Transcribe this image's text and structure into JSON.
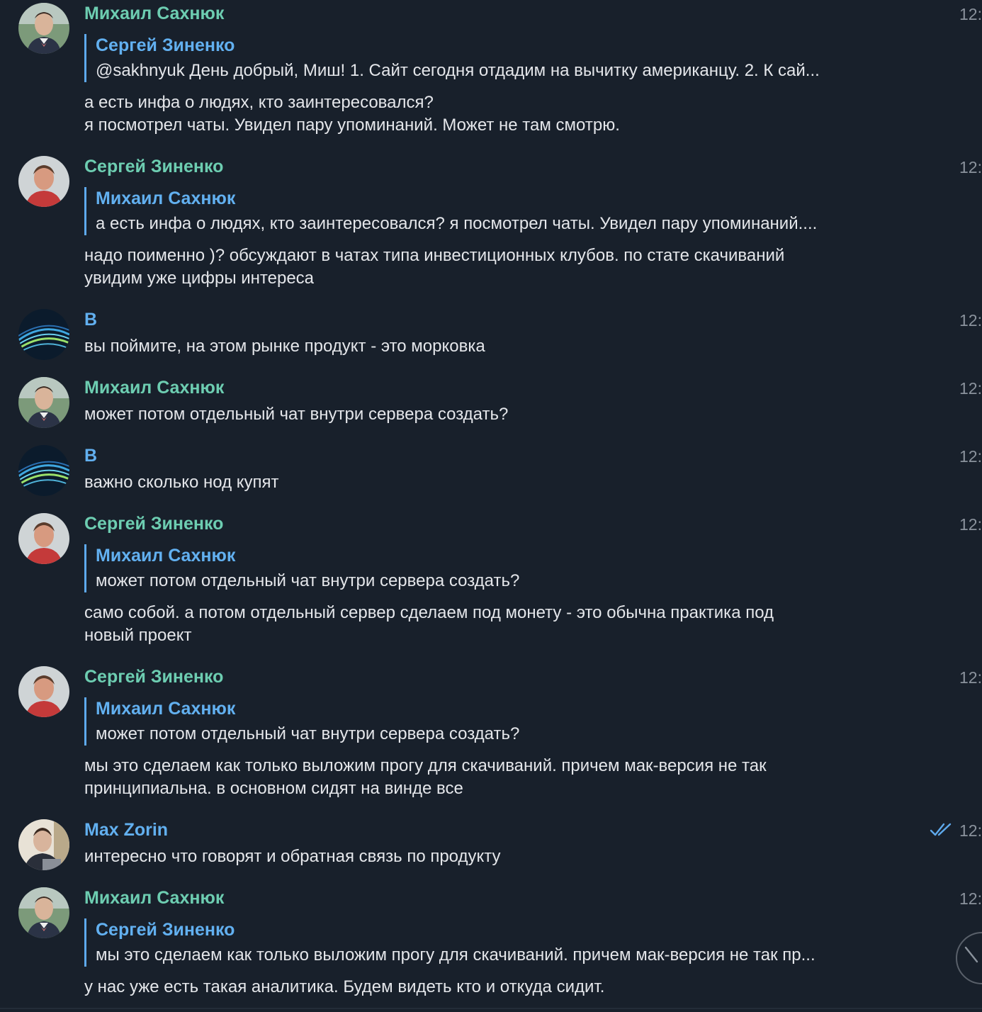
{
  "colors": {
    "background": "#18202b",
    "author_green": "#6dcdb1",
    "author_blue": "#62b0f0",
    "quote_bar": "#5ea9ec",
    "text": "#e4e6ea",
    "time": "#8a929c",
    "read_check": "#5ea9ec"
  },
  "messages": [
    {
      "author": "Михаил Сахнюк",
      "time": "12:",
      "avatar": "mikhail-avatar",
      "reply": {
        "author": "Сергей Зиненко",
        "text": "@sakhnyuk День добрый, Миш! 1. Сайт сегодня отдадим на вычитку американцу.  2. К сай..."
      },
      "lines": [
        "а есть инфа о людях, кто заинтересовался?",
        "я посмотрел чаты. Увидел пару упоминаний. Может не там смотрю."
      ]
    },
    {
      "author": "Сергей Зиненко",
      "time": "12:",
      "avatar": "sergey-avatar",
      "reply": {
        "author": "Михаил Сахнюк",
        "text": "а есть инфа о людях, кто заинтересовался?  я посмотрел чаты. Увидел пару упоминаний...."
      },
      "lines": [
        "надо поименно )? обсуждают в чатах типа инвестиционных клубов. по стате скачиваний",
        "увидим уже цифры интереса"
      ]
    },
    {
      "author": "B",
      "time": "12:",
      "avatar": "b-avatar",
      "lines": [
        "вы поймите, на этом рынке продукт - это морковка"
      ]
    },
    {
      "author": "Михаил Сахнюк",
      "time": "12:",
      "avatar": "mikhail-avatar",
      "lines": [
        "может потом отдельный чат внутри сервера создать?"
      ]
    },
    {
      "author": "B",
      "time": "12:",
      "avatar": "b-avatar",
      "lines": [
        "важно сколько нод купят"
      ]
    },
    {
      "author": "Сергей Зиненко",
      "time": "12:",
      "avatar": "sergey-avatar",
      "reply": {
        "author": "Михаил Сахнюк",
        "text": "может потом отдельный чат внутри сервера создать?"
      },
      "lines": [
        "само собой. а потом отдельный сервер сделаем под монету - это обычна практика под",
        "новый проект"
      ]
    },
    {
      "author": "Сергей Зиненко",
      "time": "12:",
      "avatar": "sergey-avatar",
      "reply": {
        "author": "Михаил Сахнюк",
        "text": "может потом отдельный чат внутри сервера создать?"
      },
      "lines": [
        "мы это сделаем как только выложим прогу для скачиваний. причем мак-версия не так",
        "принципиальна. в основном сидят на винде все"
      ]
    },
    {
      "author": "Max Zorin",
      "time": "12:",
      "avatar": "max-avatar",
      "read": true,
      "lines": [
        "интересно что говорят и обратная связь по продукту"
      ]
    },
    {
      "author": "Михаил Сахнюк",
      "time": "12:",
      "avatar": "mikhail-avatar",
      "reply": {
        "author": "Сергей Зиненко",
        "text": "мы это сделаем как только выложим прогу для скачиваний. причем мак-версия не так пр..."
      },
      "lines": [
        "у нас уже есть такая аналитика. Будем видеть кто и откуда сидит."
      ]
    }
  ]
}
